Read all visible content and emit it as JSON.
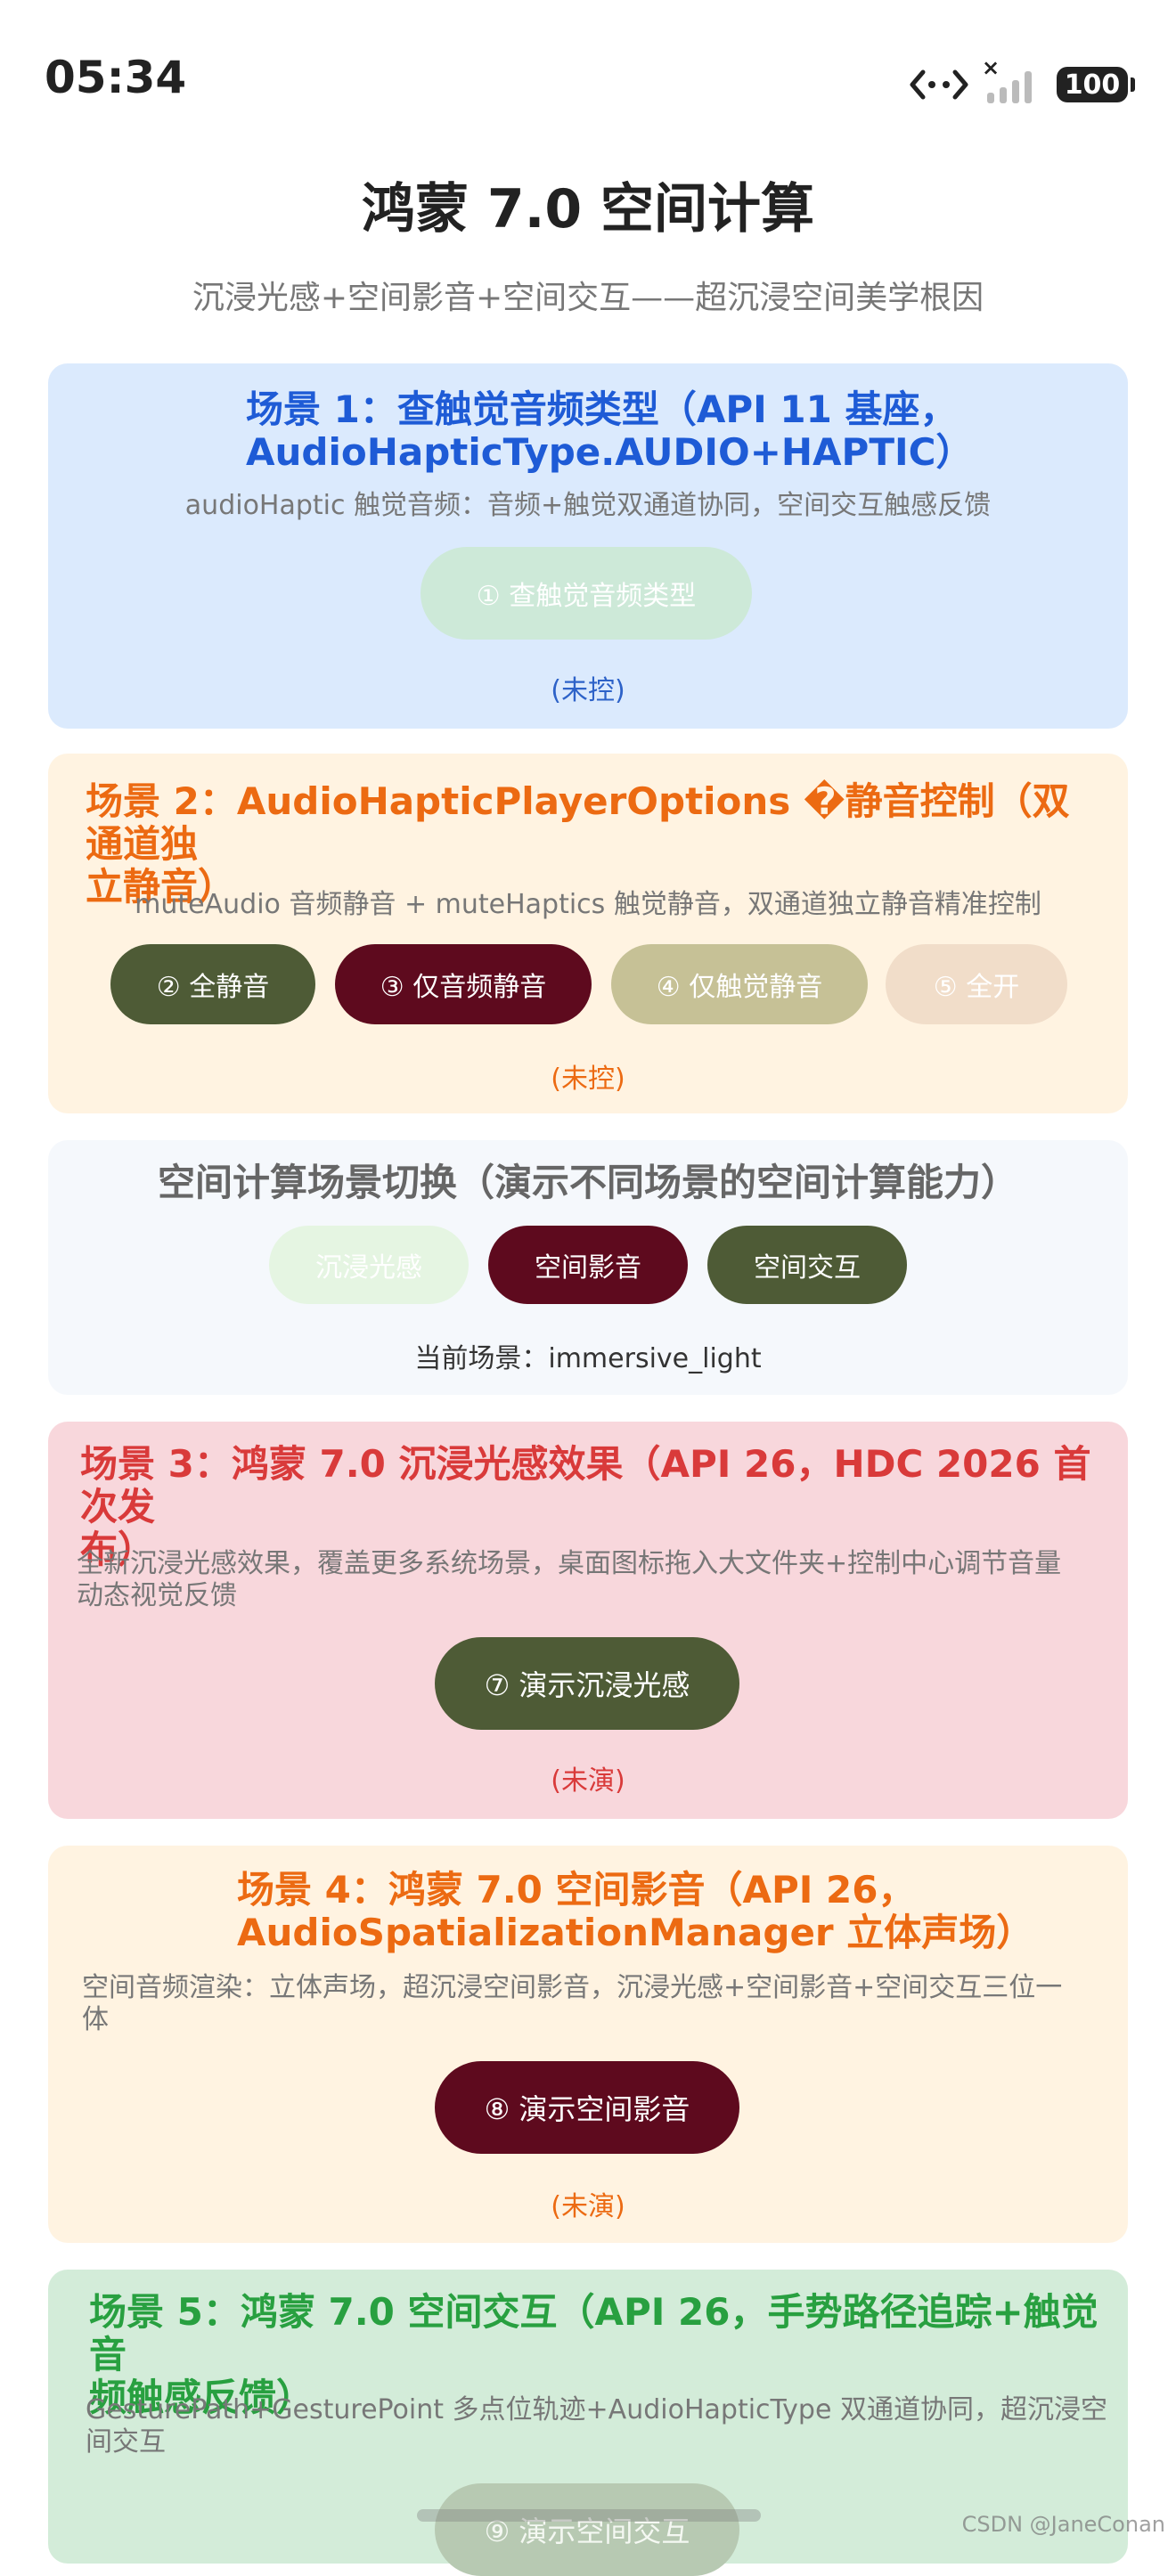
{
  "status_bar": {
    "time": "05:34",
    "battery": "100"
  },
  "header": {
    "title": "鸿蒙 7.0 空间计算",
    "subtitle": "沉浸光感+空间影音+空间交互——超沉浸空间美学根因"
  },
  "scene1": {
    "title_line1": "场景 1：查触觉音频类型（API 11 基座，",
    "title_line2": "AudioHapticType.AUDIO+HAPTIC）",
    "desc": "audioHaptic 触觉音频：音频+触觉双通道协同，空间交互触感反馈",
    "button": "① 查触觉音频类型",
    "status": "(未控)"
  },
  "scene2": {
    "title_line1": "场景 2：AudioHapticPlayerOptions �静音控制（双通道独",
    "title_line2": "立静音）",
    "desc": "muteAudio 音频静音 + muteHaptics 触觉静音，双通道独立静音精准控制",
    "buttons": [
      "② 全静音",
      "③ 仅音频静音",
      "④ 仅触觉静音",
      "⑤ 全开"
    ],
    "status": "(未控)"
  },
  "switcher": {
    "title": "空间计算场景切换（演示不同场景的空间计算能力）",
    "buttons": [
      "沉浸光感",
      "空间影音",
      "空间交互"
    ],
    "current": "当前场景：immersive_light"
  },
  "scene3": {
    "title_line1": "场景 3：鸿蒙 7.0 沉浸光感效果（API 26，HDC 2026 首次发",
    "title_line2": "布）",
    "desc_line1": "全新沉浸光感效果，覆盖更多系统场景，桌面图标拖入大文件夹+控制中心调节音量",
    "desc_line2": "动态视觉反馈",
    "button": "⑦ 演示沉浸光感",
    "status": "(未演)"
  },
  "scene4": {
    "title_line1": "场景 4：鸿蒙 7.0 空间影音（API 26，",
    "title_line2": "AudioSpatializationManager 立体声场）",
    "desc_line1": "空间音频渲染：立体声场，超沉浸空间影音，沉浸光感+空间影音+空间交互三位一",
    "desc_line2": "体",
    "button": "⑧ 演示空间影音",
    "status": "(未演)"
  },
  "scene5": {
    "title_line1": "场景 5：鸿蒙 7.0 空间交互（API 26，手势路径追踪+触觉音",
    "title_line2": "频触感反馈）",
    "desc_line1": "GesturePath+GesturePoint 多点位轨迹+AudioHapticType 双通道协同，超沉浸空",
    "desc_line2": "间交互",
    "button": "⑨ 演示空间交互"
  },
  "watermark": "CSDN @JaneConan",
  "colors": {
    "blue_title": "#1e5bd6",
    "orange_title": "#ec6a12",
    "red_title": "#d93a3a",
    "green_title": "#28a040",
    "olive_button": "#4e5b36",
    "maroon_button": "#5e0a1e"
  }
}
